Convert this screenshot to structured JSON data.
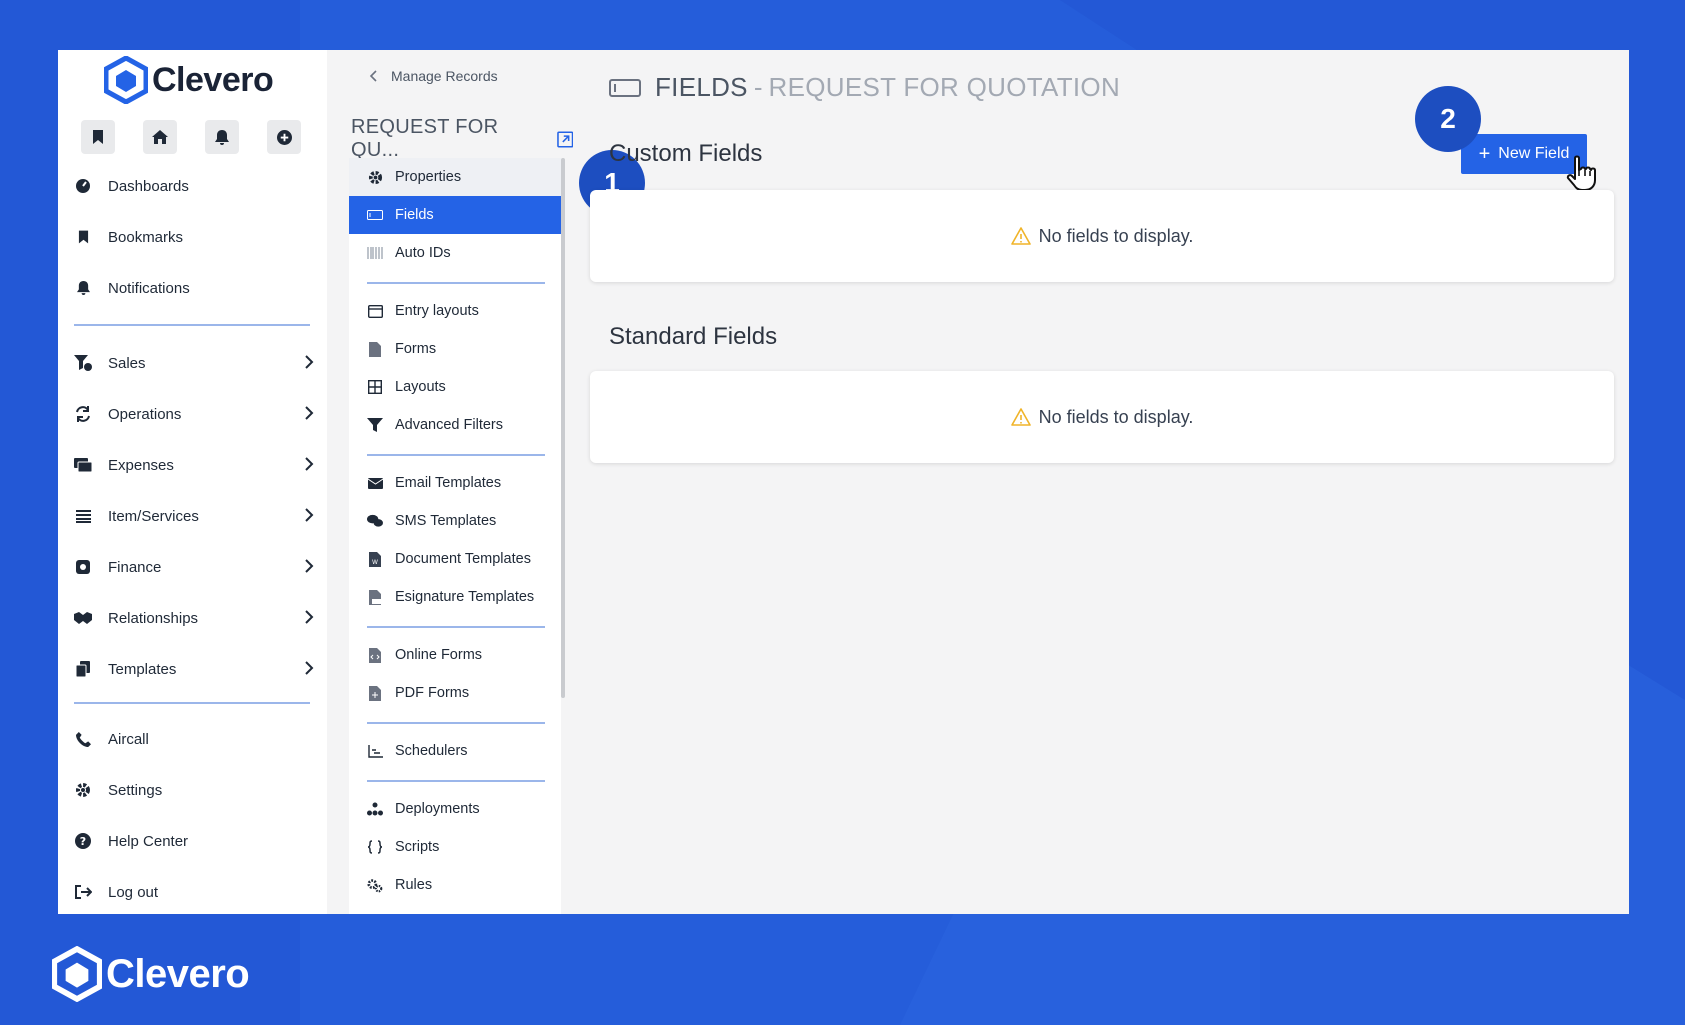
{
  "brand": {
    "name": "Clevero",
    "accent": "#2463e6",
    "badge": "#1d4ec0"
  },
  "sidebar": {
    "quick_icons": [
      "bookmark-icon",
      "home-icon",
      "bell-icon",
      "plus-circle-icon"
    ],
    "top_items": [
      {
        "label": "Dashboards",
        "icon": "dashboard-icon"
      },
      {
        "label": "Bookmarks",
        "icon": "bookmark-icon"
      },
      {
        "label": "Notifications",
        "icon": "bell-icon"
      }
    ],
    "modules": [
      {
        "label": "Sales",
        "icon": "funnel-dollar-icon"
      },
      {
        "label": "Operations",
        "icon": "sync-icon"
      },
      {
        "label": "Expenses",
        "icon": "money-icon"
      },
      {
        "label": "Item/Services",
        "icon": "list-icon"
      },
      {
        "label": "Finance",
        "icon": "finance-icon"
      },
      {
        "label": "Relationships",
        "icon": "handshake-icon"
      },
      {
        "label": "Templates",
        "icon": "copy-icon"
      }
    ],
    "bottom_items": [
      {
        "label": "Aircall",
        "icon": "phone-icon"
      },
      {
        "label": "Settings",
        "icon": "gear-icon"
      },
      {
        "label": "Help Center",
        "icon": "help-icon"
      },
      {
        "label": "Log out",
        "icon": "logout-icon"
      }
    ]
  },
  "subpanel": {
    "breadcrumb": "Manage Records",
    "record_title": "REQUEST FOR QU...",
    "menu": [
      {
        "label": "Properties",
        "icon": "gear-icon"
      },
      {
        "label": "Fields",
        "icon": "field-icon"
      },
      {
        "label": "Auto IDs",
        "icon": "barcode-icon"
      },
      {
        "label": "Entry layouts",
        "icon": "window-icon"
      },
      {
        "label": "Forms",
        "icon": "file-icon"
      },
      {
        "label": "Layouts",
        "icon": "grid-icon"
      },
      {
        "label": "Advanced Filters",
        "icon": "filter-icon"
      },
      {
        "label": "Email Templates",
        "icon": "envelope-icon"
      },
      {
        "label": "SMS Templates",
        "icon": "chat-icon"
      },
      {
        "label": "Document Templates",
        "icon": "word-file-icon"
      },
      {
        "label": "Esignature Templates",
        "icon": "pdf-file-icon"
      },
      {
        "label": "Online Forms",
        "icon": "code-file-icon"
      },
      {
        "label": "PDF Forms",
        "icon": "pdf-form-icon"
      },
      {
        "label": "Schedulers",
        "icon": "chart-icon"
      },
      {
        "label": "Deployments",
        "icon": "sitemap-icon"
      },
      {
        "label": "Scripts",
        "icon": "braces-icon"
      },
      {
        "label": "Rules",
        "icon": "gears-icon"
      }
    ]
  },
  "main": {
    "title": "FIELDS",
    "title_sep": "-",
    "subtitle": "REQUEST FOR QUOTATION",
    "custom_title": "Custom Fields",
    "custom_empty": "No fields to display.",
    "standard_title": "Standard Fields",
    "standard_empty": "No fields to display.",
    "new_field_label": "New Field"
  },
  "badges": {
    "step1": "1",
    "step2": "2"
  },
  "footer": {
    "brand": "Clevero"
  }
}
